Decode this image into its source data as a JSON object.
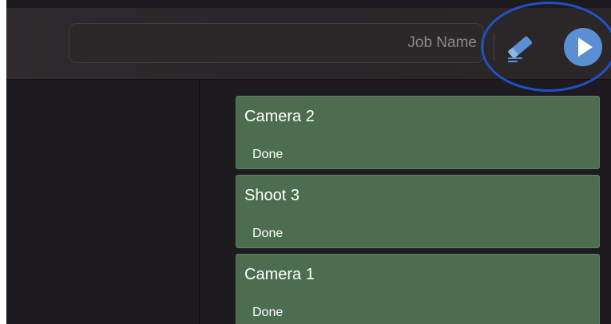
{
  "toolbar": {
    "job_name_placeholder": "Job Name",
    "eraser_icon": "eraser-icon",
    "play_icon": "play-icon",
    "accent": "#5b8fd4",
    "highlight_color": "#2350c8"
  },
  "jobs": [
    {
      "title": "Camera 2",
      "status": "Done"
    },
    {
      "title": "Shoot 3",
      "status": "Done"
    },
    {
      "title": "Camera 1",
      "status": "Done"
    }
  ],
  "colors": {
    "card_background": "#4c6d4f",
    "window_background": "#1d1a20"
  }
}
